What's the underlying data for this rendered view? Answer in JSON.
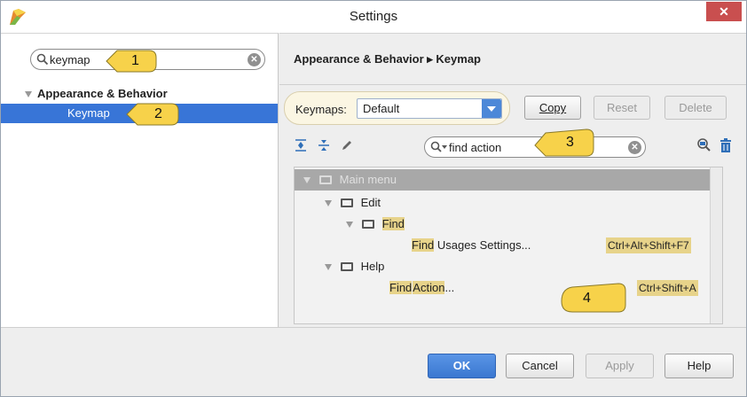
{
  "window": {
    "title": "Settings",
    "close_label": "✕"
  },
  "left_search": {
    "value": "keymap"
  },
  "settings_tree": [
    {
      "label": "Appearance & Behavior"
    },
    {
      "label": "Keymap"
    }
  ],
  "callouts": [
    "1",
    "2",
    "3",
    "4"
  ],
  "breadcrumb": "Appearance & Behavior ▸ Keymap",
  "keymaps": {
    "label": "Keymaps:",
    "selected": "Default",
    "copy": "Copy",
    "reset": "Reset",
    "delete": "Delete"
  },
  "action_search": {
    "value": "find action"
  },
  "keymap_tree": {
    "main_menu": "Main menu",
    "edit": "Edit",
    "find_folder": "Find",
    "find_word": "Find",
    "usages_rest": " Usages Settings...",
    "usages_shortcut": "Ctrl+Alt+Shift+F7",
    "help": "Help",
    "action_find": "Find",
    "action_word": "Action",
    "action_rest": "...",
    "action_shortcut": "Ctrl+Shift+A"
  },
  "footer": {
    "ok": "OK",
    "cancel": "Cancel",
    "apply": "Apply",
    "help": "Help"
  },
  "colors": {
    "selection": "#3875d7",
    "highlight": "#e7d38a",
    "callout": "#f7d24a",
    "close": "#c94f4f"
  }
}
